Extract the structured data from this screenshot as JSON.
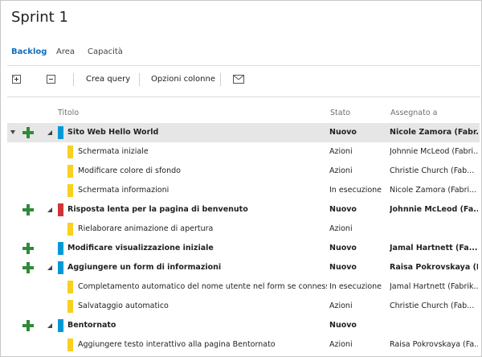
{
  "page": {
    "title": "Sprint 1"
  },
  "tabs": [
    {
      "label": "Backlog",
      "active": true
    },
    {
      "label": "Area",
      "active": false
    },
    {
      "label": "Capacità",
      "active": false
    }
  ],
  "toolbar": {
    "expand_icon": "expand-all-icon",
    "collapse_icon": "collapse-all-icon",
    "create_query": "Crea query",
    "column_options": "Opzioni colonne",
    "email_icon": "email-icon"
  },
  "columns": {
    "title": "Titolo",
    "state": "Stato",
    "assigned": "Assegnato a"
  },
  "colors": {
    "blue": "#0099d8",
    "yellow": "#f8d020",
    "red": "#d13438",
    "green": "#2e8b3a",
    "accent": "#106ebe"
  },
  "rows": [
    {
      "title": "Sito Web Hello World",
      "state": "Nuovo",
      "assigned": "Nicole Zamora (Fabr...",
      "type": "pbi",
      "color": "blue",
      "bold": true,
      "selected": true,
      "collapsible": true,
      "expanded": true
    },
    {
      "title": "Schermata iniziale",
      "state": "Azioni",
      "assigned": "Johnnie McLeod (Fabri...",
      "type": "task",
      "color": "yellow",
      "bold": false
    },
    {
      "title": "Modificare colore di sfondo",
      "state": "Azioni",
      "assigned": "Christie Church (Fab...",
      "type": "task",
      "color": "yellow",
      "bold": false
    },
    {
      "title": "Schermata informazioni",
      "state": "In esecuzione",
      "assigned": "Nicole Zamora (Fabri...",
      "type": "task",
      "color": "yellow",
      "bold": false
    },
    {
      "title": "Risposta lenta per la pagina di benvenuto",
      "state": "Nuovo",
      "assigned": "Johnnie McLeod (Fa...",
      "type": "bug",
      "color": "red",
      "bold": true,
      "collapsible": true
    },
    {
      "title": "Rielaborare animazione di apertura",
      "state": "Azioni",
      "assigned": "",
      "type": "task",
      "color": "yellow",
      "bold": false
    },
    {
      "title": "Modificare visualizzazione iniziale",
      "state": "Nuovo",
      "assigned": "Jamal Hartnett (Fa...",
      "type": "pbi",
      "color": "blue",
      "bold": true,
      "collapsible": false
    },
    {
      "title": "Aggiungere un form di informazioni",
      "state": "Nuovo",
      "assigned": "Raisa Pokrovskaya (Fa...",
      "type": "pbi",
      "color": "blue",
      "bold": true,
      "collapsible": true
    },
    {
      "title": "Completamento automatico del nome utente nel form se connesso",
      "state": "In esecuzione",
      "assigned": "Jamal Hartnett (Fabrik...",
      "type": "task",
      "color": "yellow",
      "bold": false
    },
    {
      "title": "Salvataggio automatico",
      "state": "Azioni",
      "assigned": "Christie Church (Fab...",
      "type": "task",
      "color": "yellow",
      "bold": false
    },
    {
      "title": "Bentornato",
      "state": "Nuovo",
      "assigned": "",
      "type": "pbi",
      "color": "blue",
      "bold": true,
      "collapsible": true
    },
    {
      "title": "Aggiungere testo interattivo alla pagina Bentornato",
      "state": "Azioni",
      "assigned": "Raisa Pokrovskaya (Fa...",
      "type": "task",
      "color": "yellow",
      "bold": false
    }
  ]
}
